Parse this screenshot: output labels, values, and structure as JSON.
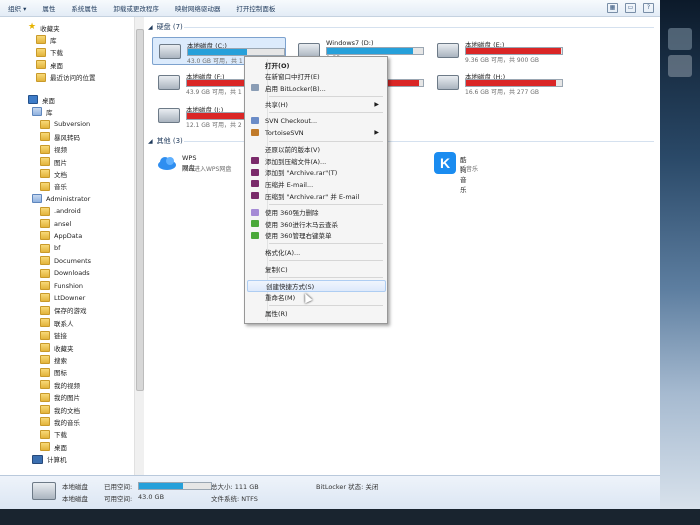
{
  "toolbar": {
    "items": [
      "组织 ▾",
      "属性",
      "系统属性",
      "卸载或更改程序",
      "映射网络驱动器",
      "打开控制面板"
    ]
  },
  "nav": {
    "favorites": "收藏夹",
    "fav_items": [
      "库",
      "下载",
      "桌面",
      "最近访问的位置"
    ],
    "desktop": "桌面",
    "library": "库",
    "lib_items": [
      "Subversion",
      "暴风转码",
      "视频",
      "图片",
      "文档",
      "音乐"
    ],
    "admin": "Administrator",
    "admin_items": [
      ".android",
      "ansel",
      "AppData",
      "bf",
      "Documents",
      "Downloads",
      "Funshion",
      "LtDowner",
      "保存的游戏",
      "联系人",
      "链接",
      "收藏夹",
      "搜索",
      "图标",
      "我的视频",
      "我的图片",
      "我的文档",
      "我的音乐",
      "下载",
      "桌面"
    ],
    "computer": "计算机"
  },
  "content": {
    "hdd_group": "硬盘 (7)",
    "other_group": "其他 (3)",
    "drives": [
      {
        "name": "本地磁盘 (C:)",
        "free": "43.0 GB 可用，共 1",
        "fill": 0.61,
        "color": "#26a0da",
        "selected": true
      },
      {
        "name": "Windows7 (D:)",
        "free": "0 GB",
        "fill": 0.9,
        "color": "#26a0da",
        "selected": false
      },
      {
        "name": "本地磁盘 (E:)",
        "free": "9.36 GB 可用，共 900 GB",
        "fill": 0.99,
        "color": "#da2626",
        "selected": false
      },
      {
        "name": "本地磁盘 (F:)",
        "free": "43.9 GB 可用，共 1",
        "fill": 0.96,
        "color": "#da2626",
        "selected": false
      },
      {
        "name": "",
        "free": "",
        "fill": 0.96,
        "color": "#da2626",
        "selected": false
      },
      {
        "name": "本地磁盘 (H:)",
        "free": "16.6 GB 可用，共 277 GB",
        "fill": 0.94,
        "color": "#da2626",
        "selected": false
      },
      {
        "name": "本地磁盘 (I:)",
        "free": "12.1 GB 可用，共 2",
        "fill": 0.95,
        "color": "#da2626",
        "selected": false
      }
    ],
    "apps": [
      {
        "name": "WPS网盘",
        "desc": "双击进入WPS网盘",
        "color": "#2f8ef0"
      },
      {
        "name": "酷狗音乐",
        "desc": "听音乐",
        "color": "#1a8cf0"
      }
    ]
  },
  "context_menu": {
    "items": [
      {
        "label": "打开(O)",
        "bold": true,
        "icon": ""
      },
      {
        "label": "在新窗口中打开(E)",
        "icon": ""
      },
      {
        "label": "启用 BitLocker(B)...",
        "icon": "bitlocker-icon"
      },
      {
        "sep": true
      },
      {
        "label": "共享(H)",
        "submenu": true,
        "icon": ""
      },
      {
        "sep": true
      },
      {
        "label": "SVN Checkout...",
        "icon": "svn-icon"
      },
      {
        "label": "TortoiseSVN",
        "submenu": true,
        "icon": "tortoise-icon"
      },
      {
        "sep": true
      },
      {
        "label": "还原以前的版本(V)",
        "icon": ""
      },
      {
        "label": "添加到压缩文件(A)...",
        "icon": "archive-icon"
      },
      {
        "label": "添加到 \"Archive.rar\"(T)",
        "icon": "archive-icon"
      },
      {
        "label": "压缩并 E-mail...",
        "icon": "archive-icon"
      },
      {
        "label": "压缩到 \"Archive.rar\" 并 E-mail",
        "icon": "archive-icon"
      },
      {
        "sep": true
      },
      {
        "label": "使用 360强力删除",
        "icon": "360-delete-icon"
      },
      {
        "label": "使用 360进行木马云查杀",
        "icon": "360-scan-icon"
      },
      {
        "label": "使用 360管理右键菜单",
        "icon": "360-manage-icon"
      },
      {
        "sep": true
      },
      {
        "label": "格式化(A)...",
        "icon": ""
      },
      {
        "sep": true
      },
      {
        "label": "复制(C)",
        "icon": ""
      },
      {
        "sep": true
      },
      {
        "label": "创建快捷方式(S)",
        "icon": "",
        "highlight": true
      },
      {
        "label": "重命名(M)",
        "icon": ""
      },
      {
        "sep": true
      },
      {
        "label": "属性(R)",
        "icon": ""
      }
    ]
  },
  "status": {
    "drive_name": "本地磁盘",
    "drive_type": "本地磁盘",
    "used_label": "已用空间:",
    "free_label": "可用空间:",
    "free_value": "43.0 GB",
    "total_label": "总大小: 111 GB",
    "fs_label": "文件系统: NTFS",
    "bitlocker": "BitLocker 状态: 关闭",
    "used_fill": 0.61
  }
}
